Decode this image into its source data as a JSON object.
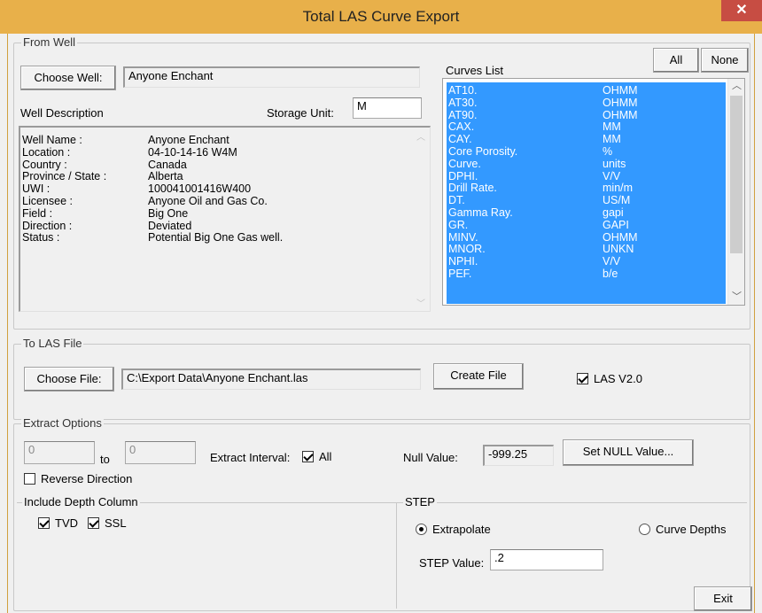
{
  "window": {
    "title": "Total LAS Curve Export",
    "close_glyph": "✕"
  },
  "from_well": {
    "group_label": "From Well",
    "choose_well_label": "Choose Well:",
    "well_name_value": "Anyone Enchant",
    "well_description_label": "Well Description",
    "storage_unit_label": "Storage Unit:",
    "storage_unit_value": "M",
    "description": [
      {
        "key": "Well Name :",
        "value": "Anyone Enchant"
      },
      {
        "key": "Location :",
        "value": "04-10-14-16 W4M"
      },
      {
        "key": "Country :",
        "value": "Canada"
      },
      {
        "key": "Province / State :",
        "value": "Alberta"
      },
      {
        "key": "UWI :",
        "value": "100041001416W400"
      },
      {
        "key": "Licensee :",
        "value": "Anyone Oil and Gas Co."
      },
      {
        "key": "Field :",
        "value": "Big One"
      },
      {
        "key": "Direction :",
        "value": "Deviated"
      },
      {
        "key": "Status :",
        "value": "Potential Big One Gas well."
      }
    ]
  },
  "curves": {
    "list_label": "Curves List",
    "all_label": "All",
    "none_label": "None",
    "items": [
      {
        "name": "AT10.",
        "unit": "OHMM"
      },
      {
        "name": "AT30.",
        "unit": "OHMM"
      },
      {
        "name": "AT90.",
        "unit": "OHMM"
      },
      {
        "name": "CAX.",
        "unit": "MM"
      },
      {
        "name": "CAY.",
        "unit": "MM"
      },
      {
        "name": "Core Porosity.",
        "unit": "%"
      },
      {
        "name": "Curve.",
        "unit": "units"
      },
      {
        "name": "DPHI.",
        "unit": "V/V"
      },
      {
        "name": "Drill Rate.",
        "unit": "min/m"
      },
      {
        "name": "DT.",
        "unit": "US/M"
      },
      {
        "name": "Gamma Ray.",
        "unit": "gapi"
      },
      {
        "name": "GR.",
        "unit": "GAPI"
      },
      {
        "name": "MINV.",
        "unit": "OHMM"
      },
      {
        "name": "MNOR.",
        "unit": "UNKN"
      },
      {
        "name": "NPHI.",
        "unit": "V/V"
      },
      {
        "name": "PEF.",
        "unit": "b/e"
      }
    ]
  },
  "to_las": {
    "group_label": "To LAS File",
    "choose_file_label": "Choose File:",
    "file_path": "C:\\Export Data\\Anyone Enchant.las",
    "create_file_label": "Create File",
    "las_v2_label": "LAS V2.0"
  },
  "extract": {
    "group_label": "Extract Options",
    "from_value": "0",
    "to_label": "to",
    "to_value": "0",
    "interval_label": "Extract Interval:",
    "all_label": "All",
    "null_value_label": "Null Value:",
    "null_value": "-999.25",
    "set_null_label": "Set NULL Value...",
    "reverse_label": "Reverse Direction"
  },
  "depth": {
    "group_label": "Include Depth Column",
    "tvd_label": "TVD",
    "ssl_label": "SSL"
  },
  "step": {
    "group_label": "STEP",
    "extrapolate_label": "Extrapolate",
    "curve_depths_label": "Curve Depths",
    "step_value_label": "STEP Value:",
    "step_value": ".2"
  },
  "footer": {
    "exit_label": "Exit"
  },
  "colors": {
    "titlebar": "#e8b04a",
    "selection": "#3399ff",
    "close": "#c74d43"
  }
}
